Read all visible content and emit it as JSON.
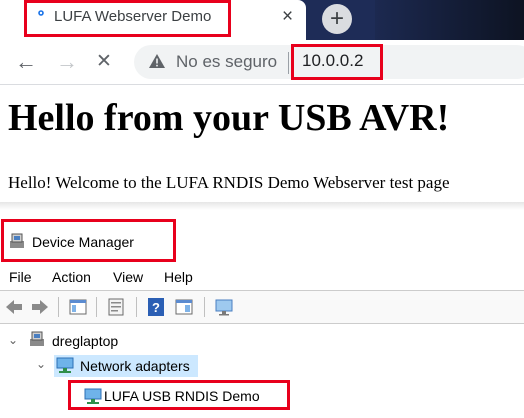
{
  "browser": {
    "tab_title": "LUFA Webserver Demo",
    "tab_close_glyph": "×",
    "new_tab_glyph": "+",
    "back_glyph": "←",
    "forward_glyph": "→",
    "stop_glyph": "✕",
    "security_text": "No es seguro",
    "url": "10.0.0.2"
  },
  "page": {
    "heading": "Hello from your USB AVR!",
    "paragraph": "Hello! Welcome to the LUFA RNDIS Demo Webserver test page"
  },
  "device_manager": {
    "title": "Device Manager",
    "menu": [
      "File",
      "Action",
      "View",
      "Help"
    ],
    "toolbar_icons": [
      "back-icon",
      "forward-icon",
      "properties-icon",
      "update-driver-icon",
      "help-icon",
      "action-icon",
      "monitor-icon"
    ],
    "tree": {
      "computer": "dreglaptop",
      "category": "Network adapters",
      "device": "LUFA USB RNDIS Demo"
    }
  },
  "colors": {
    "highlight": "#e8001c",
    "tab_strip": "#1e2c57",
    "selection": "#cce8ff"
  }
}
